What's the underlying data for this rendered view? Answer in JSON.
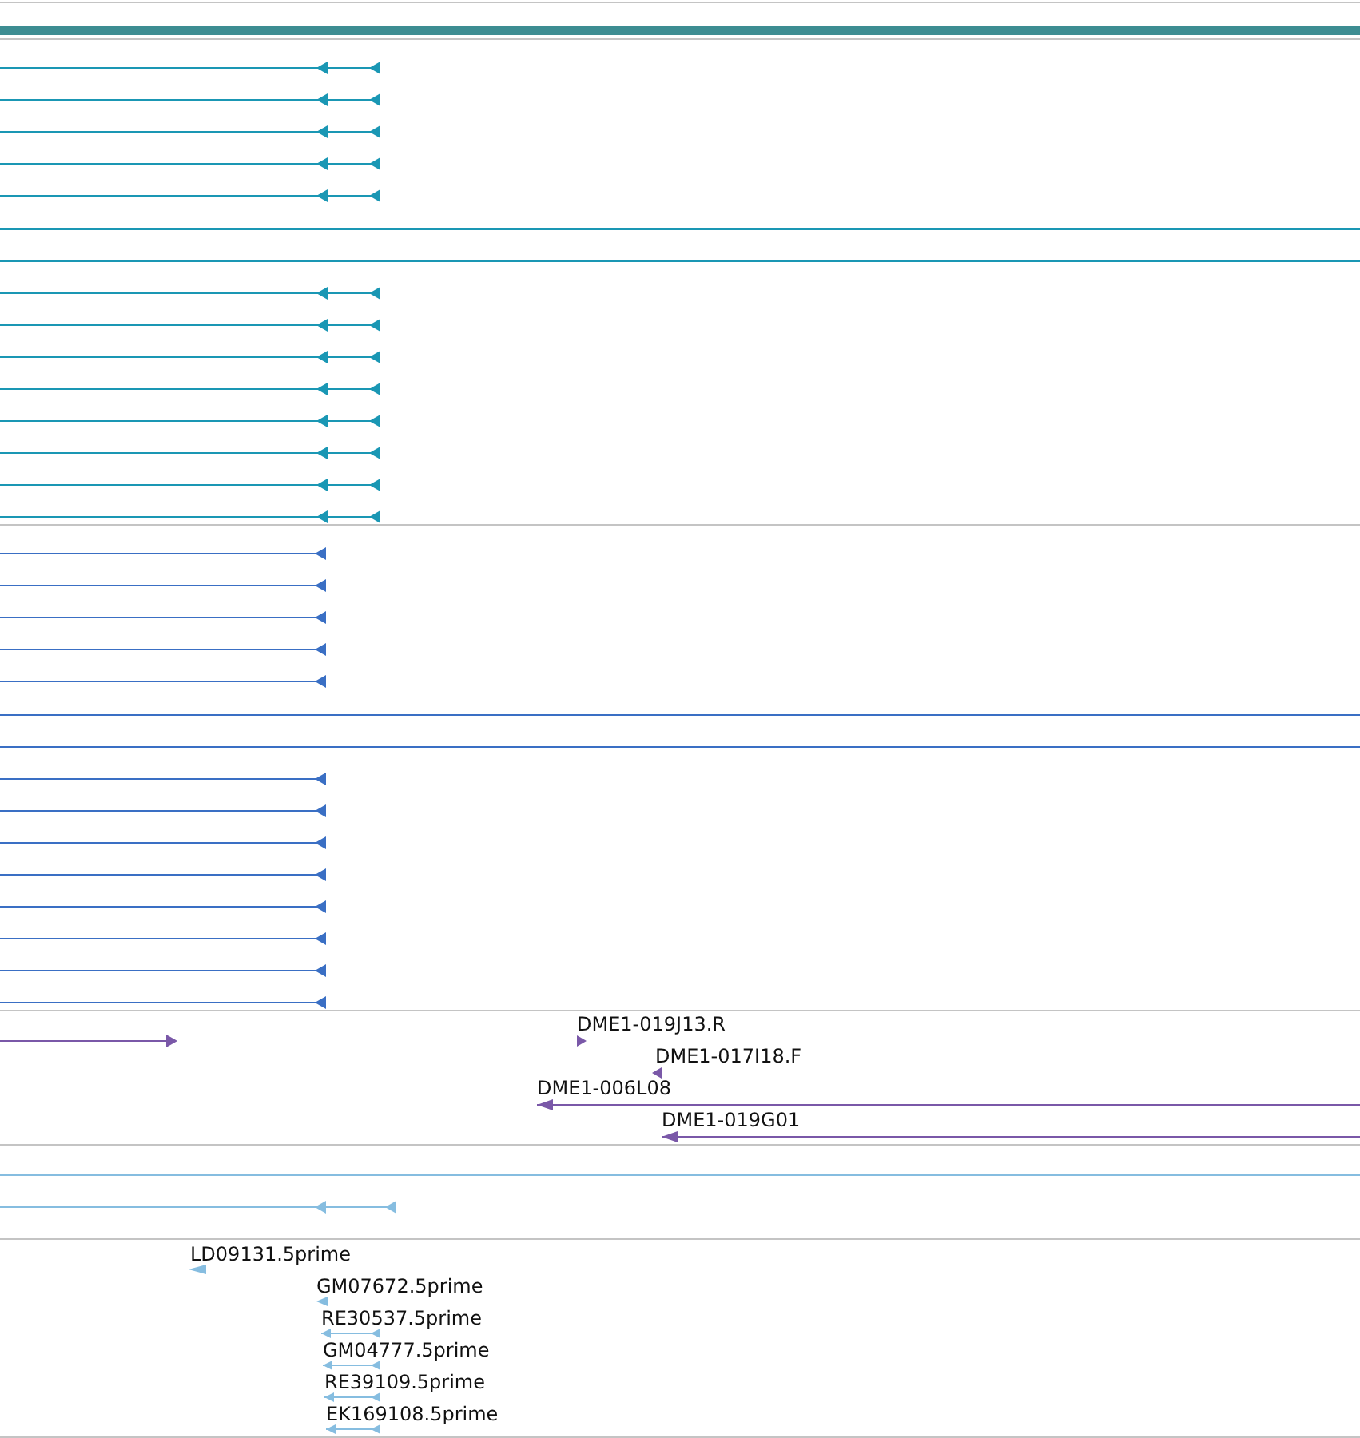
{
  "clone_track": {
    "features": [
      {
        "label": "DME1-019J13.R",
        "reverse_strand": false
      },
      {
        "label": "DME1-017I18.F",
        "reverse_strand": true
      },
      {
        "label": "DME1-006L08",
        "reverse_strand": true
      },
      {
        "label": "DME1-019G01",
        "reverse_strand": true
      }
    ]
  },
  "est_track": {
    "features": [
      {
        "label": "LD09131.5prime",
        "reverse_strand": true
      },
      {
        "label": "GM07672.5prime",
        "reverse_strand": true
      },
      {
        "label": "RE30537.5prime",
        "reverse_strand": true
      },
      {
        "label": "GM04777.5prime",
        "reverse_strand": true
      },
      {
        "label": "RE39109.5prime",
        "reverse_strand": true
      },
      {
        "label": "EK169108.5prime",
        "reverse_strand": true
      }
    ]
  }
}
